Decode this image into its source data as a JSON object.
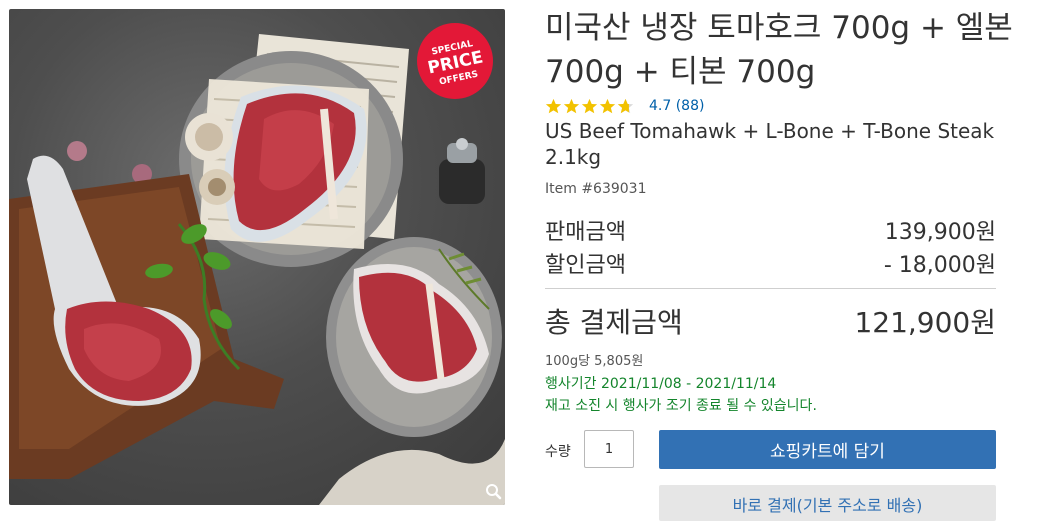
{
  "product": {
    "title": "미국산 냉장 토마호크 700g + 엘본 700g + 티본 700g",
    "subtitle": "US Beef Tomahawk + L-Bone + T-Bone Steak 2.1kg",
    "item_number": "Item #639031",
    "rating": 4.7,
    "rating_text": "4.7 (88)",
    "star_color": "#f2c200",
    "badge_lines": [
      "SPECIAL",
      "PRICE",
      "OFFERS"
    ],
    "badge_color": "#e31837"
  },
  "pricing": {
    "sale_label": "판매금액",
    "sale_value": "139,900원",
    "discount_label": "할인금액",
    "discount_value": "- 18,000원",
    "total_label": "총 결제금액",
    "total_value": "121,900원",
    "unit_price": "100g당 5,805원",
    "event_period": "행사기간 2021/11/08 - 2021/11/14",
    "notice": "재고 소진 시 행사가 조기 종료 될 수 있습니다."
  },
  "purchase": {
    "quantity_label": "수량",
    "quantity_value": "1",
    "add_to_cart_label": "쇼핑카트에 담기",
    "buy_now_label": "바로 결제(기본 주소로 배송)",
    "primary_color": "#3271b4"
  }
}
